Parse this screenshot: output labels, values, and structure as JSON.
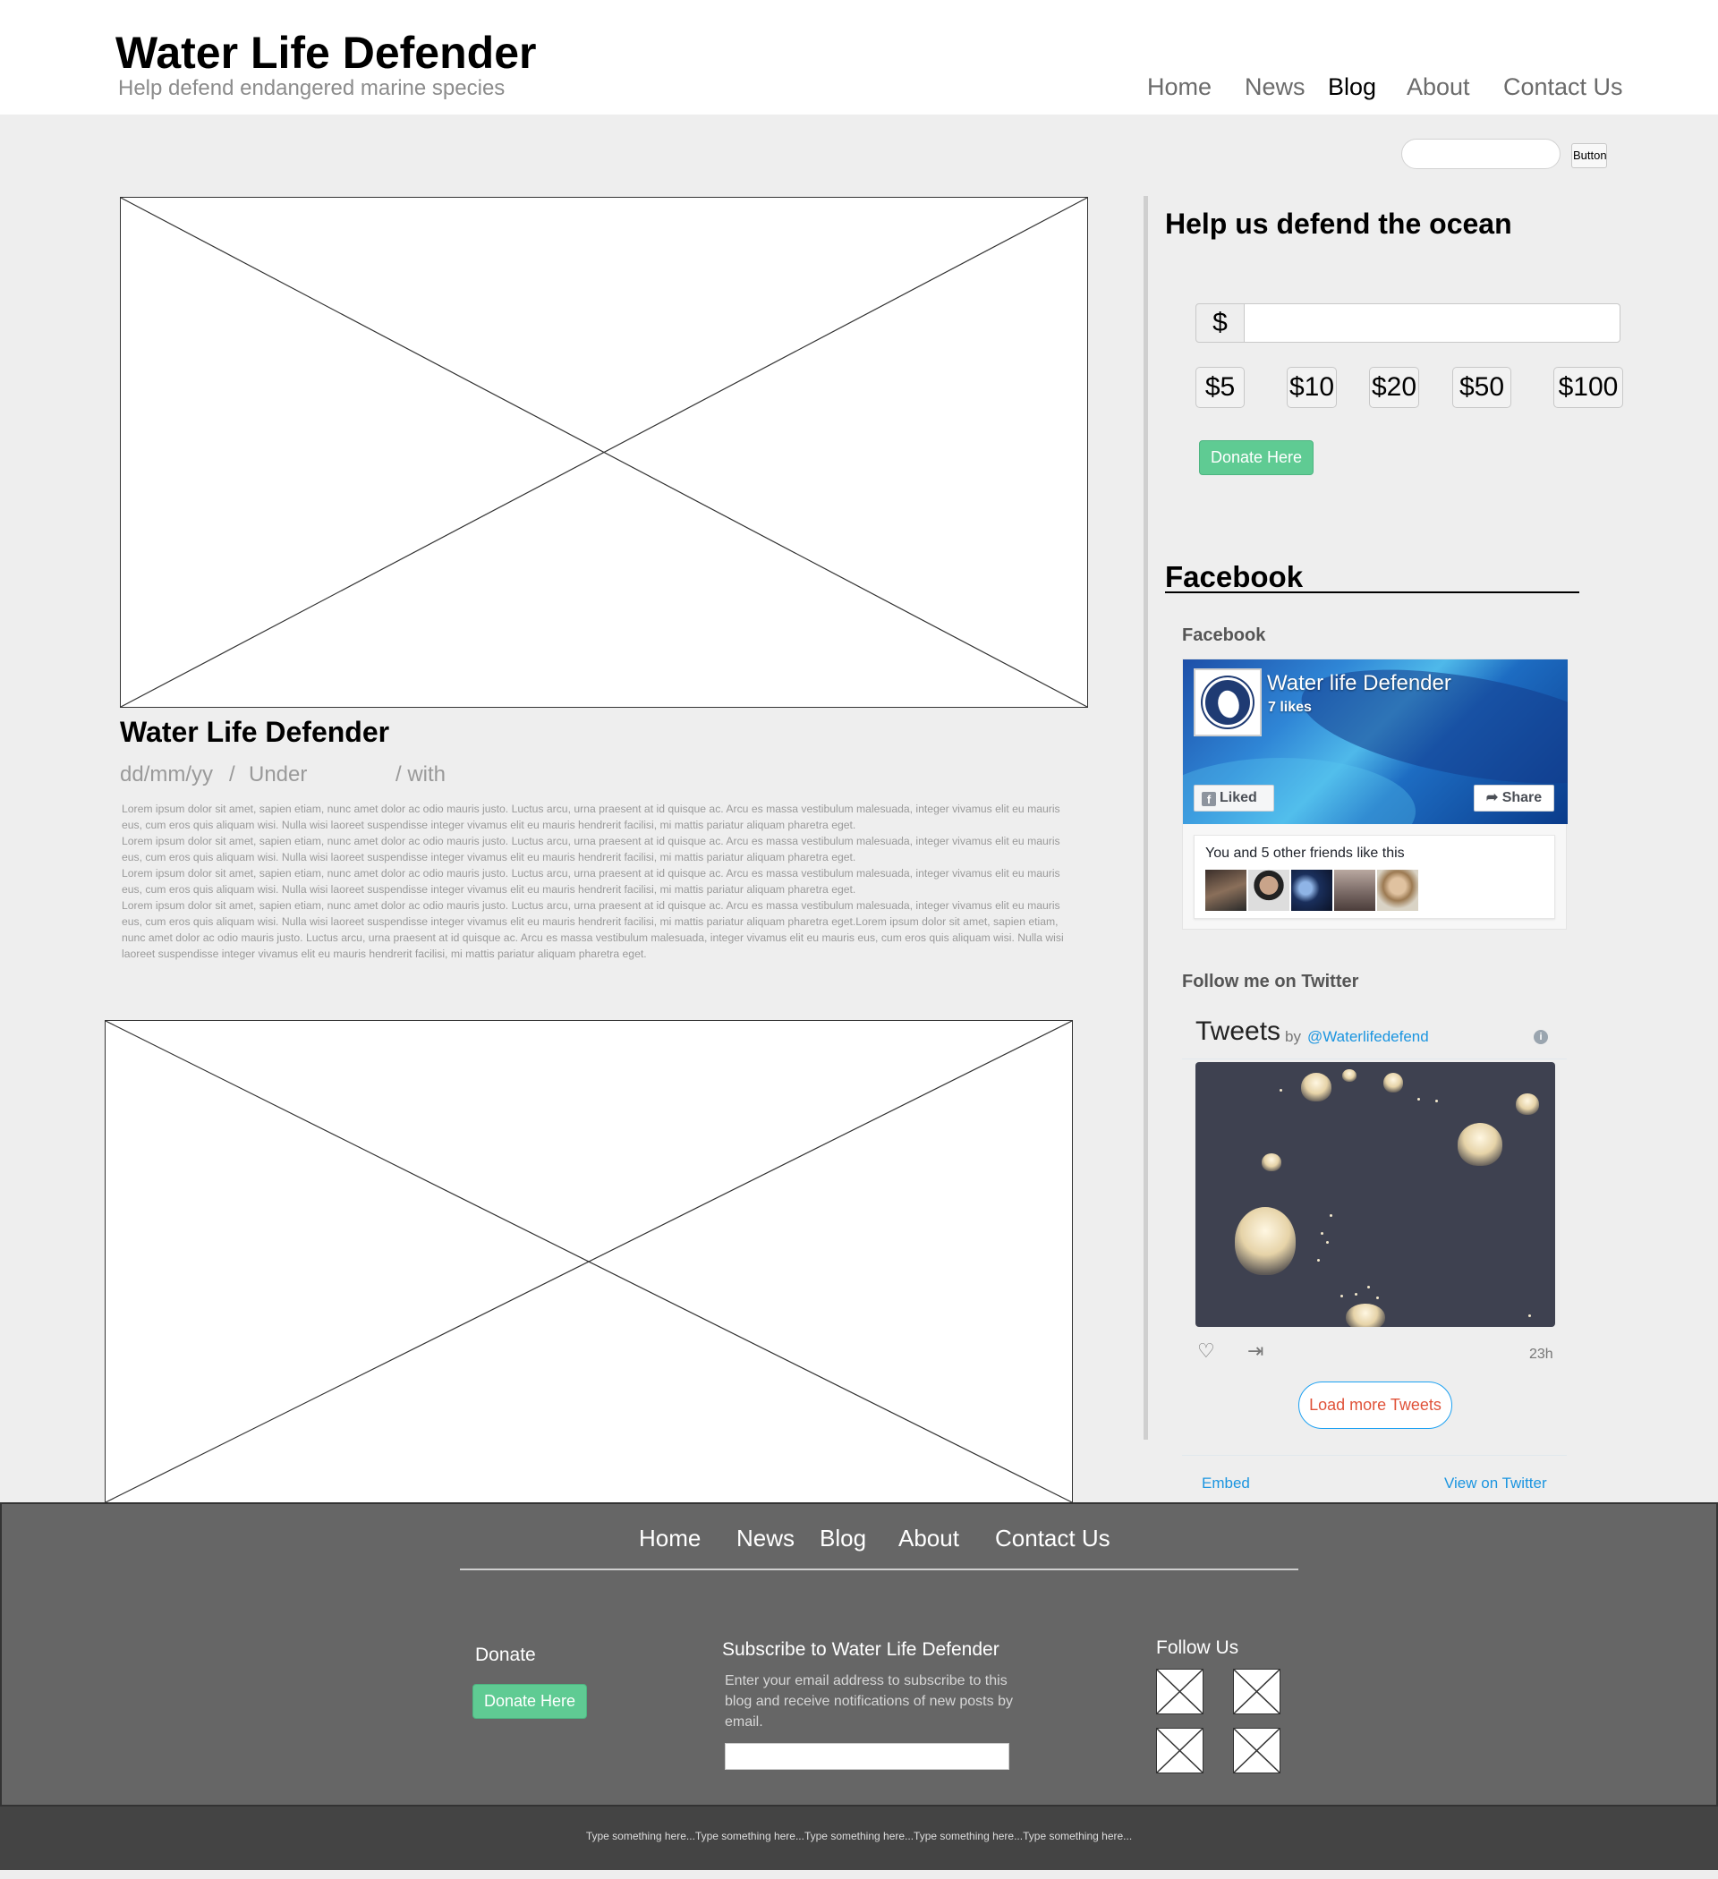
{
  "header": {
    "title": "Water Life Defender",
    "tagline": "Help defend endangered marine species",
    "nav": [
      "Home",
      "News",
      "Blog",
      "About",
      "Contact Us"
    ],
    "active_nav": "Blog"
  },
  "search": {
    "placeholder": "",
    "button_label": "Button"
  },
  "post": {
    "title": "Water Life Defender",
    "date": "dd/mm/yy",
    "sep1": "/",
    "under": "Under",
    "with": "/ with",
    "paragraphs": [
      "Lorem ipsum dolor sit amet, sapien etiam, nunc amet dolor ac odio mauris justo. Luctus arcu, urna praesent at id quisque ac. Arcu es massa vestibulum malesuada, integer vivamus elit eu mauris eus, cum eros quis aliquam wisi. Nulla wisi laoreet suspendisse integer vivamus elit eu mauris hendrerit facilisi, mi mattis pariatur aliquam pharetra eget.",
      "Lorem ipsum dolor sit amet, sapien etiam, nunc amet dolor ac odio mauris justo. Luctus arcu, urna praesent at id quisque ac. Arcu es massa vestibulum malesuada, integer vivamus elit eu mauris eus, cum eros quis aliquam wisi. Nulla wisi laoreet suspendisse integer vivamus elit eu mauris hendrerit facilisi, mi mattis pariatur aliquam pharetra eget.",
      "Lorem ipsum dolor sit amet, sapien etiam, nunc amet dolor ac odio mauris justo. Luctus arcu, urna praesent at id quisque ac. Arcu es massa vestibulum malesuada, integer vivamus elit eu mauris eus, cum eros quis aliquam wisi. Nulla wisi laoreet suspendisse integer vivamus elit eu mauris hendrerit facilisi, mi mattis pariatur aliquam pharetra eget.",
      "Lorem ipsum dolor sit amet, sapien etiam, nunc amet dolor ac odio mauris justo. Luctus arcu, urna praesent at id quisque ac. Arcu es massa vestibulum malesuada, integer vivamus elit eu mauris eus, cum eros quis aliquam wisi. Nulla wisi laoreet suspendisse integer vivamus elit eu mauris hendrerit facilisi, mi mattis pariatur aliquam pharetra eget.Lorem ipsum dolor sit amet, sapien etiam, nunc amet dolor ac odio mauris justo. Luctus arcu, urna praesent at id quisque ac. Arcu es massa vestibulum malesuada, integer vivamus elit eu mauris eus, cum eros quis aliquam wisi. Nulla wisi laoreet suspendisse integer vivamus elit eu mauris hendrerit facilisi, mi mattis pariatur aliquam pharetra eget."
    ]
  },
  "sidebar": {
    "donate_heading": "Help us defend the ocean",
    "currency_symbol": "$",
    "amounts": [
      "$5",
      "$10",
      "$20",
      "$50",
      "$100"
    ],
    "donate_button": "Donate Here",
    "facebook_heading": "Facebook",
    "facebook_sub": "Facebook",
    "twitter_sub": "Follow me on Twitter"
  },
  "facebook_widget": {
    "page_name": "Water life Defender",
    "likes": "7 likes",
    "liked_label": "Liked",
    "share_label": "Share",
    "friends_text": "You and 5 other friends like this"
  },
  "twitter_widget": {
    "title": "Tweets",
    "by": "by",
    "handle": "@Waterlifedefend",
    "time": "23h",
    "load_more": "Load more Tweets",
    "embed": "Embed",
    "view_on_twitter": "View on Twitter"
  },
  "footer": {
    "nav": [
      "Home",
      "News",
      "Blog",
      "About",
      "Contact Us"
    ],
    "donate_heading": "Donate",
    "donate_button": "Donate Here",
    "subscribe_heading": "Subscribe to Water Life Defender",
    "subscribe_desc": "Enter your email address to subscribe to this blog and receive notifications of new posts by email.",
    "follow_heading": "Follow Us",
    "bottom_text": "Type something here...Type something here...Type something here...Type something here...Type something here..."
  },
  "colors": {
    "background": "#eeeeee",
    "footer": "#666666",
    "bottom_bar": "#444444",
    "donate_green": "#5fcb93",
    "twitter_blue": "#1b95e0",
    "load_more_text": "#e0533a"
  }
}
